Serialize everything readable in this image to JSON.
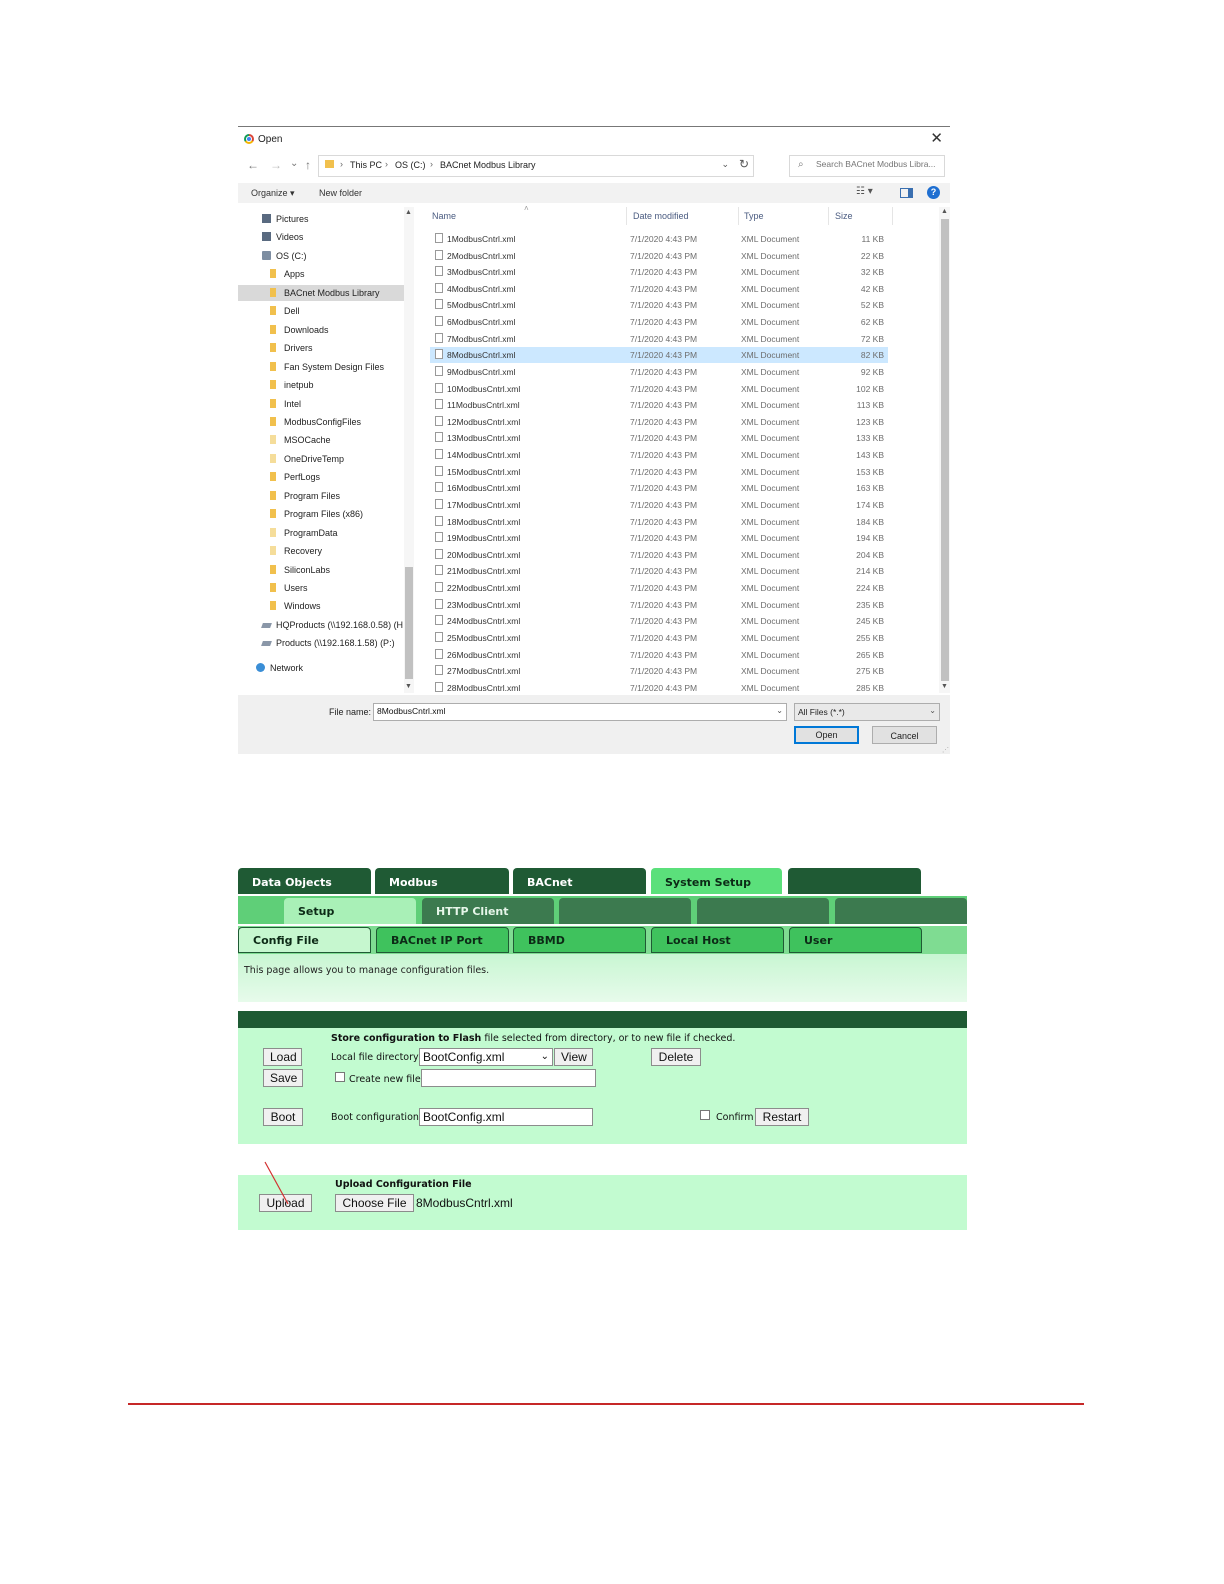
{
  "dialog": {
    "title": "Open",
    "nav": {
      "back": "←",
      "forward": "→",
      "recent": "⌄",
      "up": "↑"
    },
    "breadcrumb": [
      "This PC",
      "OS (C:)",
      "BACnet Modbus Library"
    ],
    "search_placeholder": "Search BACnet Modbus Libra...",
    "toolbar": {
      "organize": "Organize ▾",
      "new_folder": "New folder",
      "help": "?"
    },
    "nav_items": [
      {
        "label": "Pictures",
        "icon": "library"
      },
      {
        "label": "Videos",
        "icon": "library"
      },
      {
        "label": "OS (C:)",
        "icon": "drive"
      },
      {
        "label": "Apps",
        "icon": "folder"
      },
      {
        "label": "BACnet Modbus Library",
        "icon": "folder",
        "selected": true
      },
      {
        "label": "Dell",
        "icon": "folder"
      },
      {
        "label": "Downloads",
        "icon": "folder"
      },
      {
        "label": "Drivers",
        "icon": "folder"
      },
      {
        "label": "Fan System Design Files",
        "icon": "folder"
      },
      {
        "label": "inetpub",
        "icon": "folder"
      },
      {
        "label": "Intel",
        "icon": "folder"
      },
      {
        "label": "ModbusConfigFiles",
        "icon": "folder"
      },
      {
        "label": "MSOCache",
        "icon": "folder-faint"
      },
      {
        "label": "OneDriveTemp",
        "icon": "folder-faint"
      },
      {
        "label": "PerfLogs",
        "icon": "folder"
      },
      {
        "label": "Program Files",
        "icon": "folder"
      },
      {
        "label": "Program Files (x86)",
        "icon": "folder"
      },
      {
        "label": "ProgramData",
        "icon": "folder-faint"
      },
      {
        "label": "Recovery",
        "icon": "folder-faint"
      },
      {
        "label": "SiliconLabs",
        "icon": "folder"
      },
      {
        "label": "Users",
        "icon": "folder"
      },
      {
        "label": "Windows",
        "icon": "folder"
      },
      {
        "label": "HQProducts (\\\\192.168.0.58) (H",
        "icon": "network-drive"
      },
      {
        "label": "Products (\\\\192.168.1.58) (P:)",
        "icon": "network-drive"
      },
      {
        "label": "Network",
        "icon": "network"
      }
    ],
    "columns": {
      "name": "Name",
      "date": "Date modified",
      "type": "Type",
      "size": "Size"
    },
    "files": [
      {
        "name": "1ModbusCntrl.xml",
        "date": "7/1/2020 4:43 PM",
        "type": "XML Document",
        "size": "11 KB"
      },
      {
        "name": "2ModbusCntrl.xml",
        "date": "7/1/2020 4:43 PM",
        "type": "XML Document",
        "size": "22 KB"
      },
      {
        "name": "3ModbusCntrl.xml",
        "date": "7/1/2020 4:43 PM",
        "type": "XML Document",
        "size": "32 KB"
      },
      {
        "name": "4ModbusCntrl.xml",
        "date": "7/1/2020 4:43 PM",
        "type": "XML Document",
        "size": "42 KB"
      },
      {
        "name": "5ModbusCntrl.xml",
        "date": "7/1/2020 4:43 PM",
        "type": "XML Document",
        "size": "52 KB"
      },
      {
        "name": "6ModbusCntrl.xml",
        "date": "7/1/2020 4:43 PM",
        "type": "XML Document",
        "size": "62 KB"
      },
      {
        "name": "7ModbusCntrl.xml",
        "date": "7/1/2020 4:43 PM",
        "type": "XML Document",
        "size": "72 KB"
      },
      {
        "name": "8ModbusCntrl.xml",
        "date": "7/1/2020 4:43 PM",
        "type": "XML Document",
        "size": "82 KB",
        "selected": true
      },
      {
        "name": "9ModbusCntrl.xml",
        "date": "7/1/2020 4:43 PM",
        "type": "XML Document",
        "size": "92 KB"
      },
      {
        "name": "10ModbusCntrl.xml",
        "date": "7/1/2020 4:43 PM",
        "type": "XML Document",
        "size": "102 KB"
      },
      {
        "name": "11ModbusCntrl.xml",
        "date": "7/1/2020 4:43 PM",
        "type": "XML Document",
        "size": "113 KB"
      },
      {
        "name": "12ModbusCntrl.xml",
        "date": "7/1/2020 4:43 PM",
        "type": "XML Document",
        "size": "123 KB"
      },
      {
        "name": "13ModbusCntrl.xml",
        "date": "7/1/2020 4:43 PM",
        "type": "XML Document",
        "size": "133 KB"
      },
      {
        "name": "14ModbusCntrl.xml",
        "date": "7/1/2020 4:43 PM",
        "type": "XML Document",
        "size": "143 KB"
      },
      {
        "name": "15ModbusCntrl.xml",
        "date": "7/1/2020 4:43 PM",
        "type": "XML Document",
        "size": "153 KB"
      },
      {
        "name": "16ModbusCntrl.xml",
        "date": "7/1/2020 4:43 PM",
        "type": "XML Document",
        "size": "163 KB"
      },
      {
        "name": "17ModbusCntrl.xml",
        "date": "7/1/2020 4:43 PM",
        "type": "XML Document",
        "size": "174 KB"
      },
      {
        "name": "18ModbusCntrl.xml",
        "date": "7/1/2020 4:43 PM",
        "type": "XML Document",
        "size": "184 KB"
      },
      {
        "name": "19ModbusCntrl.xml",
        "date": "7/1/2020 4:43 PM",
        "type": "XML Document",
        "size": "194 KB"
      },
      {
        "name": "20ModbusCntrl.xml",
        "date": "7/1/2020 4:43 PM",
        "type": "XML Document",
        "size": "204 KB"
      },
      {
        "name": "21ModbusCntrl.xml",
        "date": "7/1/2020 4:43 PM",
        "type": "XML Document",
        "size": "214 KB"
      },
      {
        "name": "22ModbusCntrl.xml",
        "date": "7/1/2020 4:43 PM",
        "type": "XML Document",
        "size": "224 KB"
      },
      {
        "name": "23ModbusCntrl.xml",
        "date": "7/1/2020 4:43 PM",
        "type": "XML Document",
        "size": "235 KB"
      },
      {
        "name": "24ModbusCntrl.xml",
        "date": "7/1/2020 4:43 PM",
        "type": "XML Document",
        "size": "245 KB"
      },
      {
        "name": "25ModbusCntrl.xml",
        "date": "7/1/2020 4:43 PM",
        "type": "XML Document",
        "size": "255 KB"
      },
      {
        "name": "26ModbusCntrl.xml",
        "date": "7/1/2020 4:43 PM",
        "type": "XML Document",
        "size": "265 KB"
      },
      {
        "name": "27ModbusCntrl.xml",
        "date": "7/1/2020 4:43 PM",
        "type": "XML Document",
        "size": "275 KB"
      },
      {
        "name": "28ModbusCntrl.xml",
        "date": "7/1/2020 4:43 PM",
        "type": "XML Document",
        "size": "285 KB"
      }
    ],
    "footer": {
      "file_name_label": "File name:",
      "file_name_value": "8ModbusCntrl.xml",
      "file_type": "All Files (*.*)",
      "open": "Open",
      "cancel": "Cancel"
    }
  },
  "webui": {
    "tabs_row1": [
      {
        "label": "Data Objects"
      },
      {
        "label": "Modbus"
      },
      {
        "label": "BACnet"
      },
      {
        "label": "System Setup",
        "active": true
      },
      {
        "label": ""
      }
    ],
    "tabs_row2": [
      {
        "label": "Setup",
        "active": true
      },
      {
        "label": "HTTP Client"
      },
      {
        "label": ""
      },
      {
        "label": ""
      },
      {
        "label": ""
      }
    ],
    "tabs_row3": [
      {
        "label": "Config File",
        "active": true
      },
      {
        "label": "BACnet IP Port"
      },
      {
        "label": "BBMD"
      },
      {
        "label": "Local Host"
      },
      {
        "label": "User"
      }
    ],
    "description": "This page allows you to manage configuration files.",
    "config": {
      "heading_bold": "Store configuration to Flash",
      "heading_rest": " file selected from directory, or to new file if checked.",
      "load": "Load",
      "save": "Save",
      "boot": "Boot",
      "local_dir_label": "Local file directory",
      "local_dir_value": "BootConfig.xml",
      "view": "View",
      "delete": "Delete",
      "create_new_label": "Create new file",
      "create_new_value": "",
      "boot_config_label": "Boot configuration",
      "boot_config_value": "BootConfig.xml",
      "confirm_label": "Confirm",
      "restart": "Restart"
    },
    "upload": {
      "heading": "Upload Configuration File",
      "upload": "Upload",
      "choose_file": "Choose File",
      "chosen_file": "8ModbusCntrl.xml"
    }
  },
  "colors": {
    "accent_red": "#c62828",
    "selection_blue": "#cce8ff",
    "tab_dark_green": "#1f5a34",
    "tab_active_green": "#5be07b",
    "panel_mint": "#c2fbd0"
  }
}
